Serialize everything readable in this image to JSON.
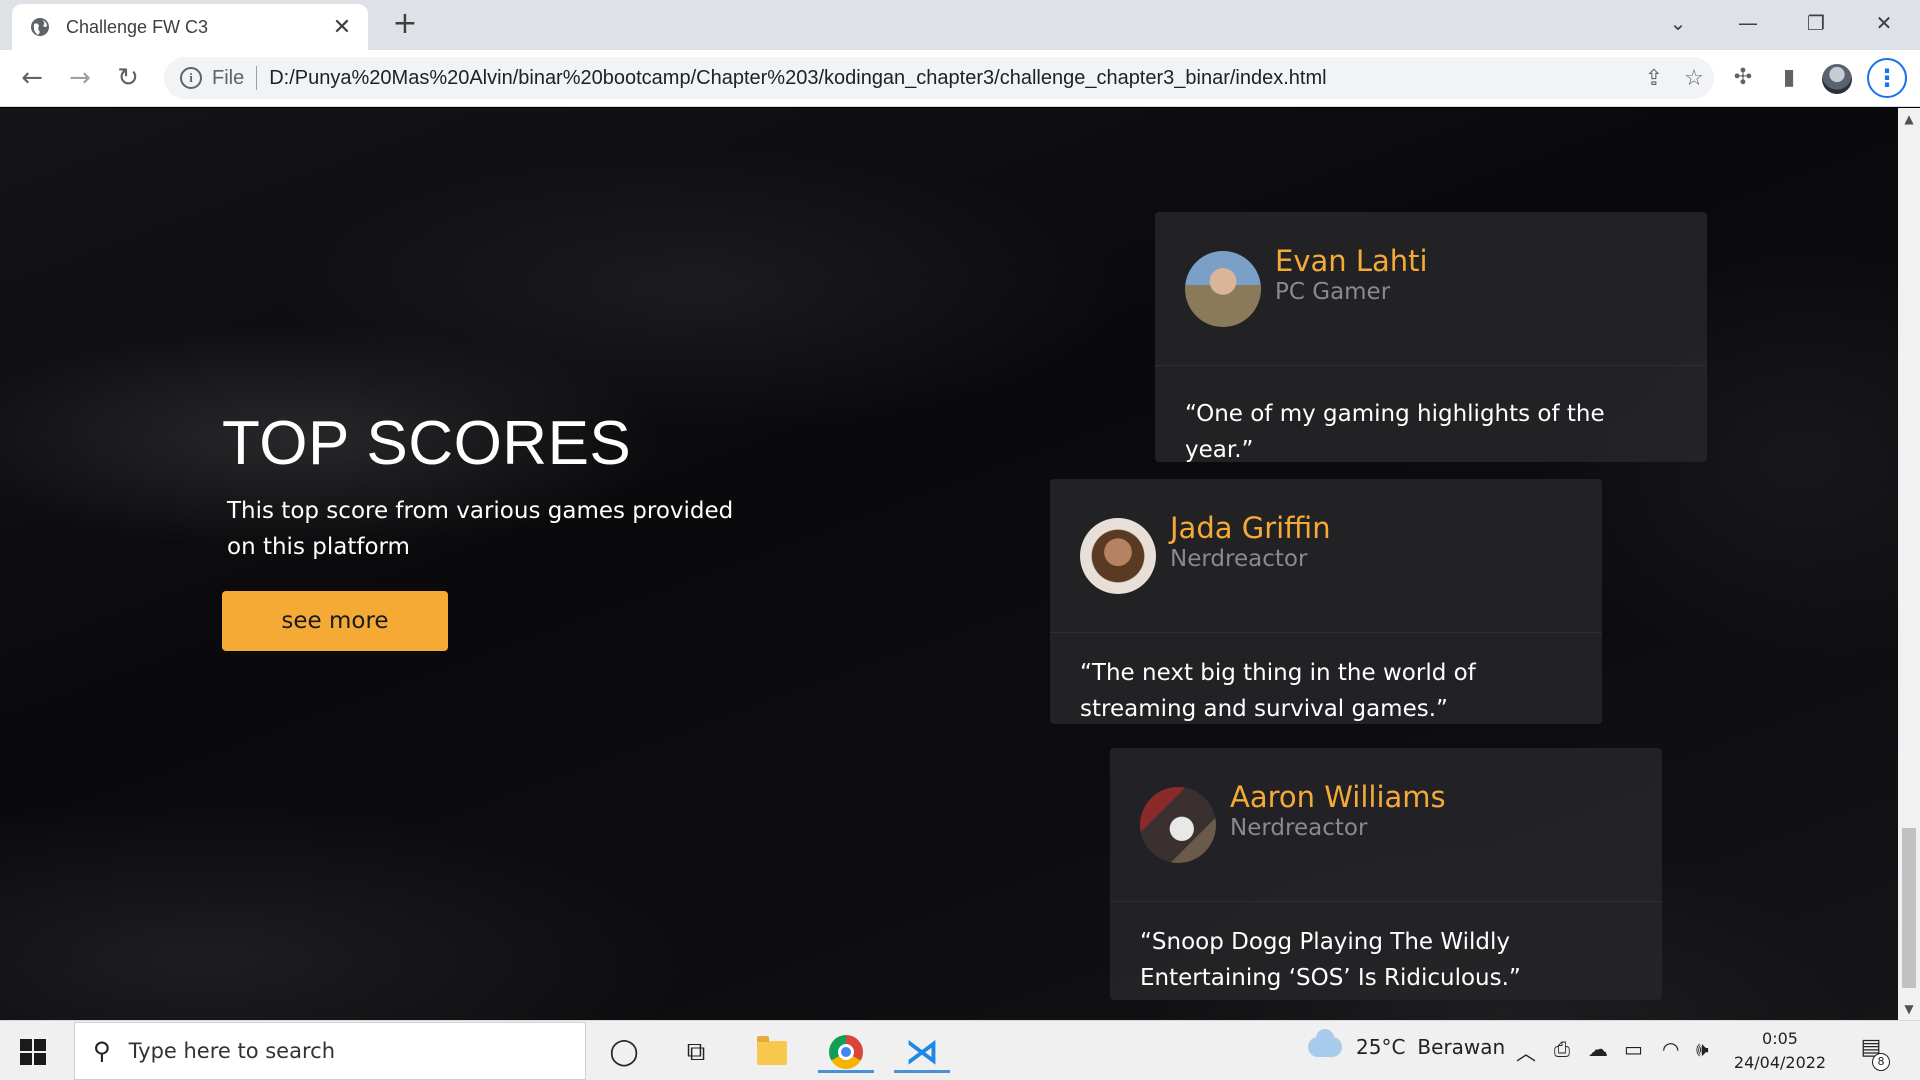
{
  "browser": {
    "tab_title": "Challenge FW C3",
    "new_tab": "+",
    "file_label": "File",
    "url": "D:/Punya%20Mas%20Alvin/binar%20bootcamp/Chapter%203/kodingan_chapter3/challenge_chapter3_binar/index.html"
  },
  "hero": {
    "title": "TOP SCORES",
    "description": "This top score from various games provided on this platform",
    "button": "see more"
  },
  "testimonials": [
    {
      "name": "Evan Lahti",
      "role": "PC Gamer",
      "quote": "“One of my gaming highlights of the year.”"
    },
    {
      "name": "Jada Griffin",
      "role": "Nerdreactor",
      "quote": "“The next big thing in the world of streaming and survival games.”"
    },
    {
      "name": "Aaron Williams",
      "role": "Nerdreactor",
      "quote": "“Snoop Dogg Playing The Wildly Entertaining ‘SOS’ Is Ridiculous.”"
    }
  ],
  "taskbar": {
    "search_placeholder": "Type here to search",
    "weather_temp": "25°C",
    "weather_desc": "Berawan",
    "time": "0:05",
    "date": "24/04/2022",
    "notification_count": "8"
  },
  "colors": {
    "accent": "#f5aa36",
    "card_bg": "#262629",
    "role_text": "#8a8a8e"
  }
}
